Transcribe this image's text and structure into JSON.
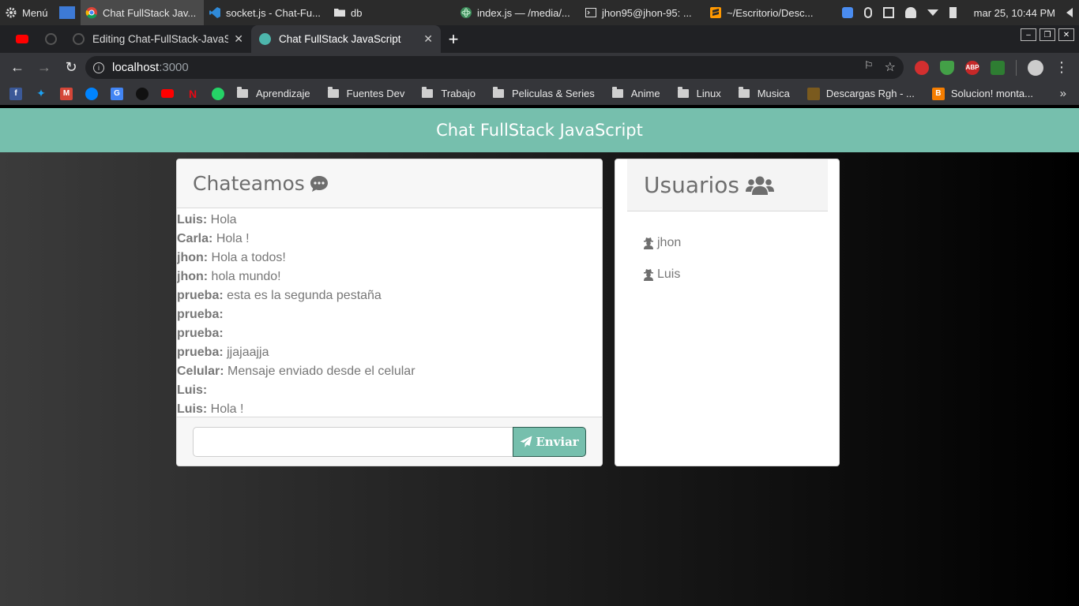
{
  "taskbar": {
    "menu_label": "Menú",
    "items": [
      {
        "label": "Chat FullStack Jav...",
        "icon": "chrome-icon",
        "active": true
      },
      {
        "label": "socket.js - Chat-Fu...",
        "icon": "vscode-icon",
        "active": false
      },
      {
        "label": "db",
        "icon": "folder-icon",
        "active": false
      },
      {
        "label": "index.js — /media/...",
        "icon": "atom-icon",
        "active": false
      },
      {
        "label": "jhon95@jhon-95: ...",
        "icon": "terminal-icon",
        "active": false
      },
      {
        "label": "~/Escritorio/Desc...",
        "icon": "sublime-icon",
        "active": false
      }
    ],
    "clock": "mar 25, 10:44 PM"
  },
  "browser": {
    "tabs": [
      {
        "label": "Editing Chat-FullStack-JavaSc",
        "icon": "github-icon",
        "active": false
      },
      {
        "label": "Chat FullStack JavaScript",
        "icon": "chat-favicon-icon",
        "active": true
      }
    ],
    "address": {
      "host": "localhost",
      "port": ":3000"
    },
    "bookmarks": {
      "folders": [
        "Aprendizaje",
        "Fuentes Dev",
        "Trabajo",
        "Peliculas & Series",
        "Anime",
        "Linux",
        "Musica"
      ],
      "links": [
        "Descargas Rgh - ...",
        "Solucion! monta..."
      ]
    }
  },
  "app": {
    "title": "Chat FullStack JavaScript",
    "chat": {
      "heading": "Chateamos",
      "messages": [
        {
          "user": "Luis:",
          "text": "Hola"
        },
        {
          "user": "Carla:",
          "text": "Hola !"
        },
        {
          "user": "jhon:",
          "text": "Hola a todos!"
        },
        {
          "user": "jhon:",
          "text": "hola mundo!"
        },
        {
          "user": "prueba:",
          "text": "esta es la segunda pestaña"
        },
        {
          "user": "prueba:",
          "text": ""
        },
        {
          "user": "prueba:",
          "text": ""
        },
        {
          "user": "prueba:",
          "text": "jjajaajja"
        },
        {
          "user": "Celular:",
          "text": "Mensaje enviado desde el celular"
        },
        {
          "user": "Luis:",
          "text": ""
        },
        {
          "user": "Luis:",
          "text": "Hola !"
        }
      ],
      "input_value": "",
      "send_label": "Enviar"
    },
    "users": {
      "heading": "Usuarios",
      "list": [
        "jhon",
        "Luis"
      ]
    }
  },
  "colors": {
    "accent": "#76bfad",
    "text_muted": "#777777"
  }
}
